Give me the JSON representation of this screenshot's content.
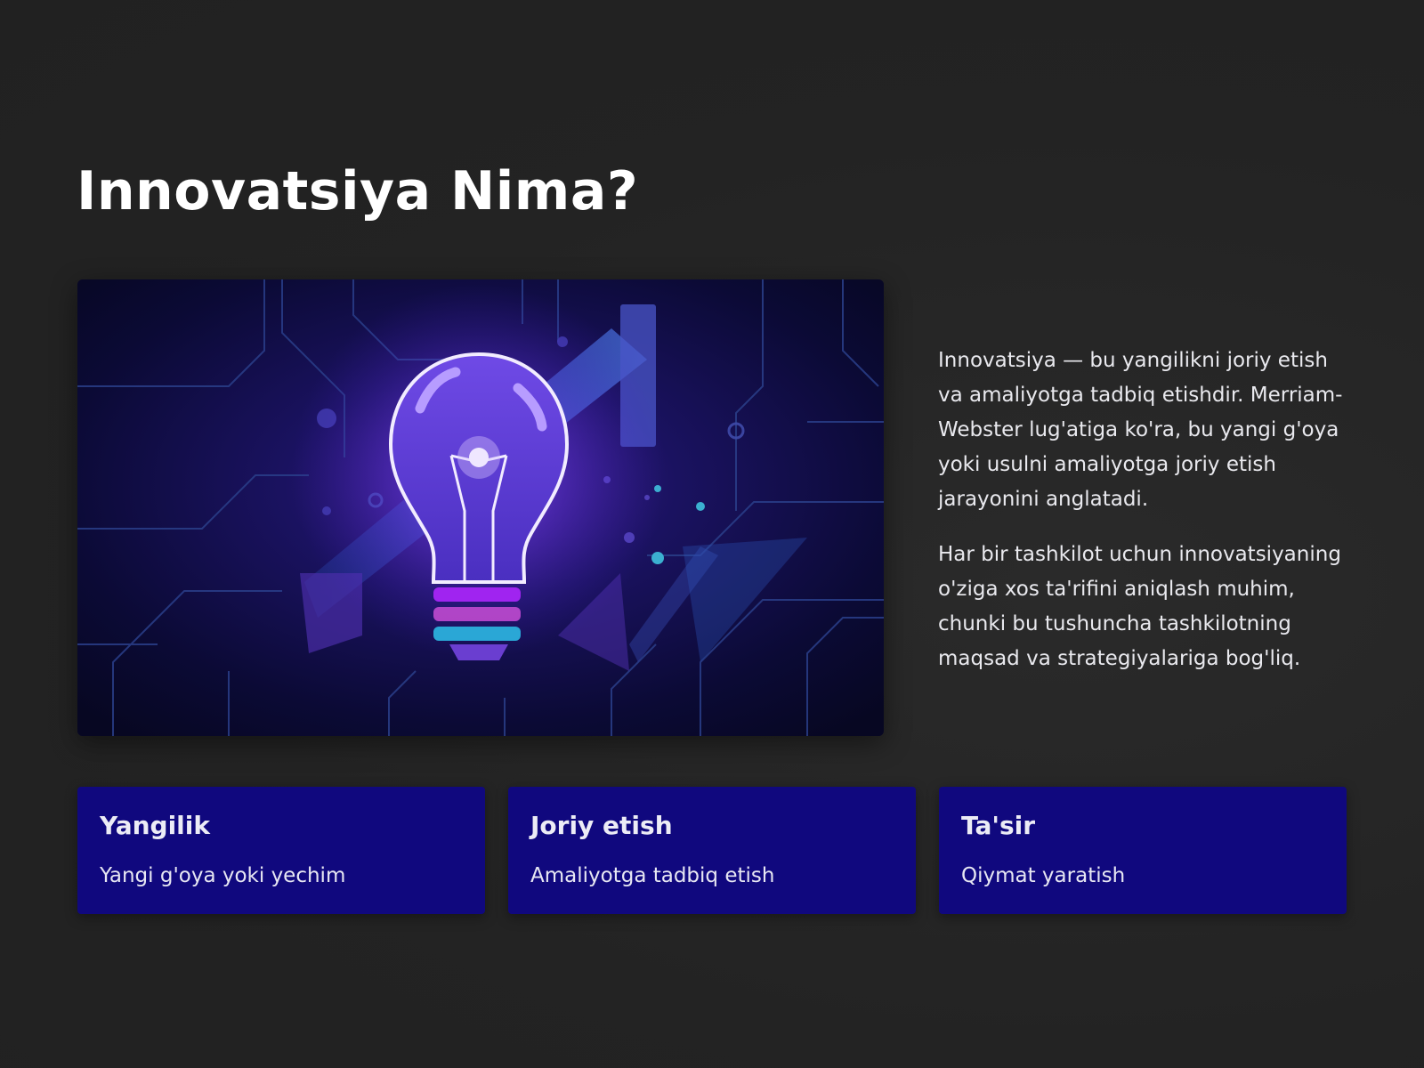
{
  "title": "Innovatsiya Nima?",
  "hero_image": {
    "subject": "glowing lightbulb over circuit board",
    "colors": {
      "background": "#0a0a2e",
      "glow": "#8a5cff",
      "accent_blue": "#3b6fd8",
      "accent_purple": "#9b30ff",
      "accent_teal": "#2bb6d6"
    }
  },
  "paragraphs": [
    "Innovatsiya — bu yangilikni joriy etish va amaliyotga tadbiq etishdir. Merriam-Webster lug'atiga ko'ra, bu yangi g'oya yoki usulni amaliyotga joriy etish jarayonini anglatadi.",
    "Har bir tashkilot uchun innovatsiyaning o'ziga xos ta'rifini aniqlash muhim, chunki bu tushuncha tashkilotning maqsad va strategiyalariga bog'liq."
  ],
  "cards": [
    {
      "title": "Yangilik",
      "subtitle": "Yangi g'oya yoki yechim"
    },
    {
      "title": "Joriy etish",
      "subtitle": "Amaliyotga tadbiq etish"
    },
    {
      "title": "Ta'sir",
      "subtitle": "Qiymat yaratish"
    }
  ],
  "colors": {
    "page_background": "#232323",
    "card_background": "#10087e",
    "text": "#ffffff"
  }
}
